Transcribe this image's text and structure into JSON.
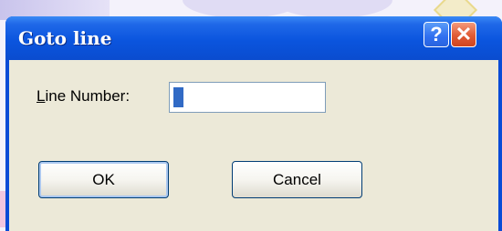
{
  "dialog": {
    "title": "Goto line",
    "help_button": "?",
    "close_button": "✕"
  },
  "form": {
    "label_access_key": "L",
    "label_rest": "ine Number:",
    "line_number_value": "1"
  },
  "buttons": {
    "ok_label": "OK",
    "cancel_label": "Cancel"
  },
  "colors": {
    "titlebar": "#0b55de",
    "client_background": "#ece9d8",
    "close_button": "#e05a34"
  }
}
